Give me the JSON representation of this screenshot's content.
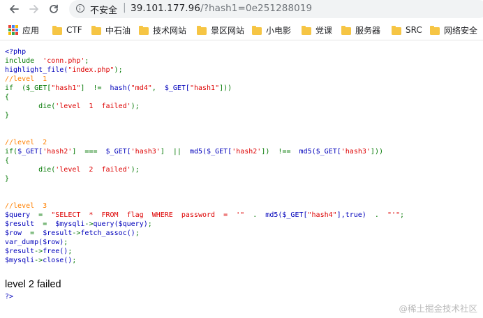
{
  "browser": {
    "security_label": "不安全",
    "url_separator": "|",
    "url_host": "39.101.177.96",
    "url_path": "/?hash1=0e251288019",
    "nav_icons": {
      "back": "arrow-left",
      "forward": "arrow-right",
      "reload": "reload"
    }
  },
  "bookmarks": {
    "apps_label": "应用",
    "items": [
      {
        "label": "CTF"
      },
      {
        "label": "中石油"
      },
      {
        "label": "技术网站"
      },
      {
        "label": "景区网站"
      },
      {
        "label": "小电影"
      },
      {
        "label": "党课"
      },
      {
        "label": "服务器"
      },
      {
        "label": "SRC"
      },
      {
        "label": "网络安全"
      }
    ]
  },
  "source": {
    "open_tag": "<?php",
    "include_kw": "include",
    "include_str": "'conn.php'",
    "highlight_call": "highlight_file(",
    "highlight_str": "\"index.php\"",
    "highlight_end": ");",
    "l1_comment": "//level  1",
    "l1_if": "if",
    "l1_open": "  ($_GET[",
    "l1_key1": "\"hash1\"",
    "l1_mid1": "]",
    "l1_op": "  !=  ",
    "l1_hash": "hash(",
    "l1_algo": "\"md4\"",
    "l1_comma": ",  ",
    "l1_get2": "$_GET[",
    "l1_key2": "\"hash1\"",
    "l1_close": "]))",
    "brace_open": "{",
    "die_kw": "die(",
    "l1_msg": "'level  1  failed'",
    "die_end": ");",
    "brace_close": "}",
    "l2_comment": "//level  2",
    "l2_if": "if(",
    "l2_get1": "$_GET[",
    "l2_key1": "'hash2'",
    "l2_rb1": "]",
    "l2_eq": "  ===  ",
    "l2_get2": "$_GET[",
    "l2_key2": "'hash3'",
    "l2_rb2": "]",
    "l2_or": "  ||  ",
    "l2_md5a": "md5($_GET[",
    "l2_key3": "'hash2'",
    "l2_rb3": "])",
    "l2_neq": "  !==  ",
    "l2_md5b": "md5($_GET[",
    "l2_key4": "'hash3'",
    "l2_close": "]))",
    "l2_msg": "'level  2  failed'",
    "l3_comment": "//level  3",
    "q_var": "$query",
    "q_eq": "  =  ",
    "q_str": "\"SELECT  *  FROM  flag  WHERE  password  =  '\"",
    "q_dot1": "  .  ",
    "q_md5": "md5($_GET[",
    "q_key": "\"hash4\"",
    "q_rest": "],true)",
    "q_dot2": "  .  ",
    "q_str2": "\"'\"",
    "q_end": ";",
    "r_var": "$result",
    "r_eq": "  =  ",
    "r_obj": "$mysqli",
    "r_arrow": "->",
    "r_call": "query($query)",
    "r_end": ";",
    "row_var": "$row",
    "row_eq": "  =  ",
    "row_obj": "$result",
    "row_arrow": "->",
    "row_call": "fetch_assoc()",
    "row_end": ";",
    "vd_call": "var_dump($row)",
    "vd_end": ";",
    "free_obj": "$result",
    "free_arrow": "->",
    "free_call": "free()",
    "free_end": ";",
    "close_obj": "$mysqli",
    "close_arrow": "->",
    "close_call": "close()",
    "close_end": ";",
    "close_tag": "?>"
  },
  "output": "level 2 failed",
  "watermark": "@稀土掘金技术社区",
  "colors": {
    "php_comment": "#ff8000",
    "php_keyword": "#007700",
    "php_default": "#0000bb",
    "php_string": "#dd0000",
    "bookmark_folder": "#f6c544"
  }
}
